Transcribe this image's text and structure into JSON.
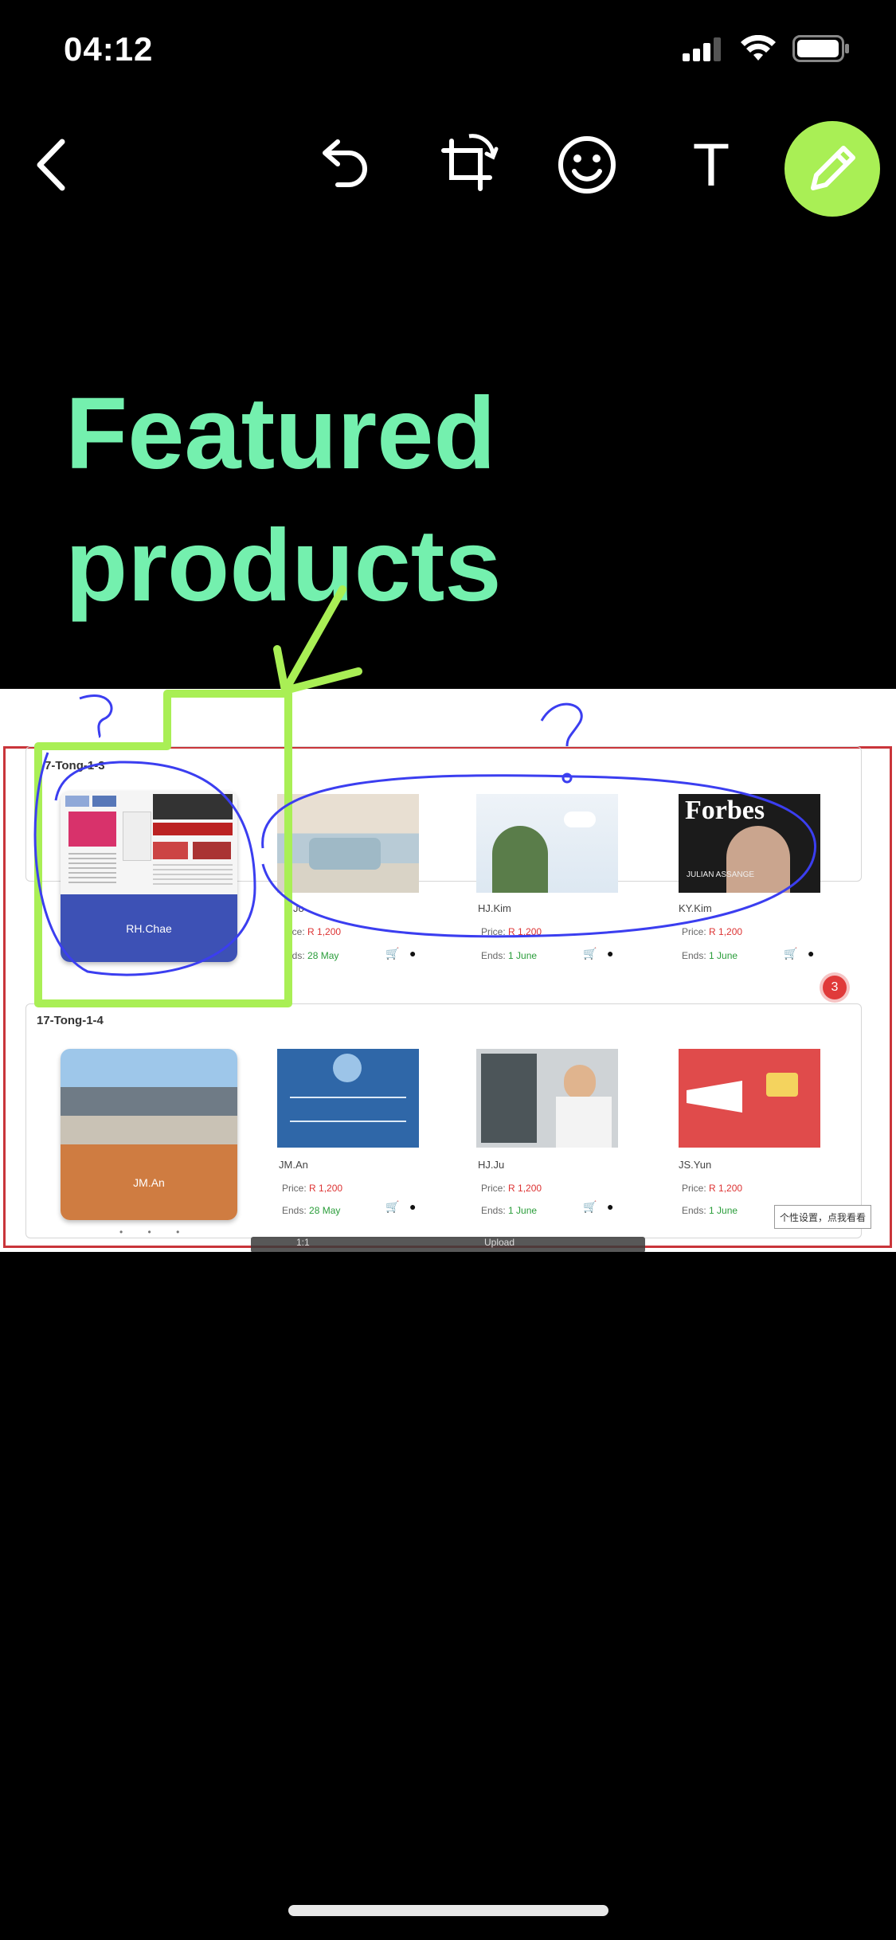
{
  "status_bar": {
    "time": "04:12"
  },
  "toolbar": {
    "back_icon": "chevron-left-icon",
    "undo_icon": "undo-icon",
    "crop_icon": "crop-rotate-icon",
    "emoji_icon": "smiley-icon",
    "text_icon": "text-icon",
    "text_label": "T",
    "pencil_icon": "pencil-icon",
    "accent": "#a9ef55"
  },
  "annotation": {
    "caption_line1": "Featured",
    "caption_line2": "products",
    "caption_color": "#74f0ae"
  },
  "screenshot": {
    "section1": {
      "title": "7-Tong-1-3",
      "featured_card_label": "RH.Chae",
      "items": [
        {
          "name": "Jo",
          "price_label": "rice: ",
          "price": "R 1,200",
          "ends_label": "nds: ",
          "ends": "28 May"
        },
        {
          "name": "HJ.Kim",
          "price_label": "Price: ",
          "price": "R 1,200",
          "ends_label": "Ends: ",
          "ends": "1 June"
        },
        {
          "name": "KY.Kim",
          "price_label": "Price: ",
          "price": "R 1,200",
          "ends_label": "Ends: ",
          "ends": "1 June"
        }
      ],
      "magazine_title": "Forbes",
      "magazine_subtitle": "JULIAN ASSANGE"
    },
    "section2": {
      "title": "17-Tong-1-4",
      "featured_card_label": "JM.An",
      "items": [
        {
          "name": "JM.An",
          "price_label": "Price: ",
          "price": "R 1,200",
          "ends_label": "Ends: ",
          "ends": "28 May"
        },
        {
          "name": "HJ.Ju",
          "price_label": "Price: ",
          "price": "R 1,200",
          "ends_label": "Ends: ",
          "ends": "1 June"
        },
        {
          "name": "JS.Yun",
          "price_label": "Price: ",
          "price": "R 1,200",
          "ends_label": "Ends: ",
          "ends": "1 June"
        }
      ]
    },
    "badge_count": "3",
    "tooltip": "个性设置，点我看看",
    "mini_toolbar_zoom": "1:1",
    "mini_toolbar_upload": "Upload"
  }
}
